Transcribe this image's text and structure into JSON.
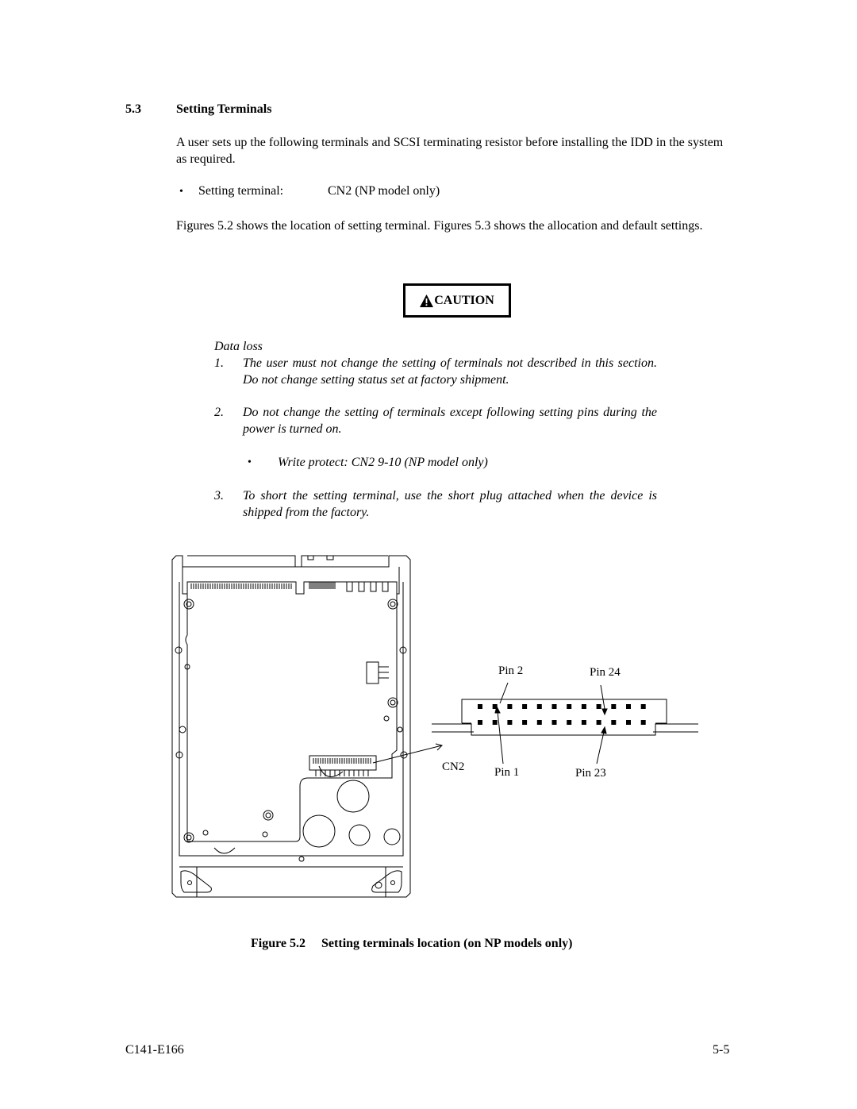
{
  "section": {
    "number": "5.3",
    "title": "Setting Terminals"
  },
  "intro": "A user sets up the following terminals and SCSI terminating resistor before installing the IDD in the system as required.",
  "setting_terminal": {
    "bullet": "•",
    "label": "Setting terminal:",
    "value": "CN2 (NP model only)"
  },
  "figures_text": "Figures 5.2 shows the location of setting terminal.  Figures 5.3 shows the allocation and default settings.",
  "caution": {
    "label": "CAUTION",
    "icon": "warning-triangle-icon",
    "heading": "Data loss",
    "items": [
      {
        "num": "1.",
        "text": "The user must not change the setting of terminals not described in this section.  Do not change setting status set at factory shipment."
      },
      {
        "num": "2.",
        "text": "Do not change the setting of terminals except following setting pins during the power is turned on."
      },
      {
        "num": "3.",
        "text": "To short the setting terminal, use the short plug attached when the device is shipped from the factory."
      }
    ],
    "sub_bullet": {
      "bullet": "•",
      "text": "Write protect:  CN2  9-10 (NP model only)"
    }
  },
  "figure": {
    "connector_label": "CN2",
    "pin_labels": {
      "pin2": "Pin 2",
      "pin24": "Pin 24",
      "pin1": "Pin 1",
      "pin23": "Pin 23"
    },
    "pins_per_row": 12,
    "rows": 2,
    "caption_number": "Figure 5.2",
    "caption_text": "Setting terminals location (on NP models only)"
  },
  "footer": {
    "doc_id": "C141-E166",
    "page": "5-5"
  }
}
